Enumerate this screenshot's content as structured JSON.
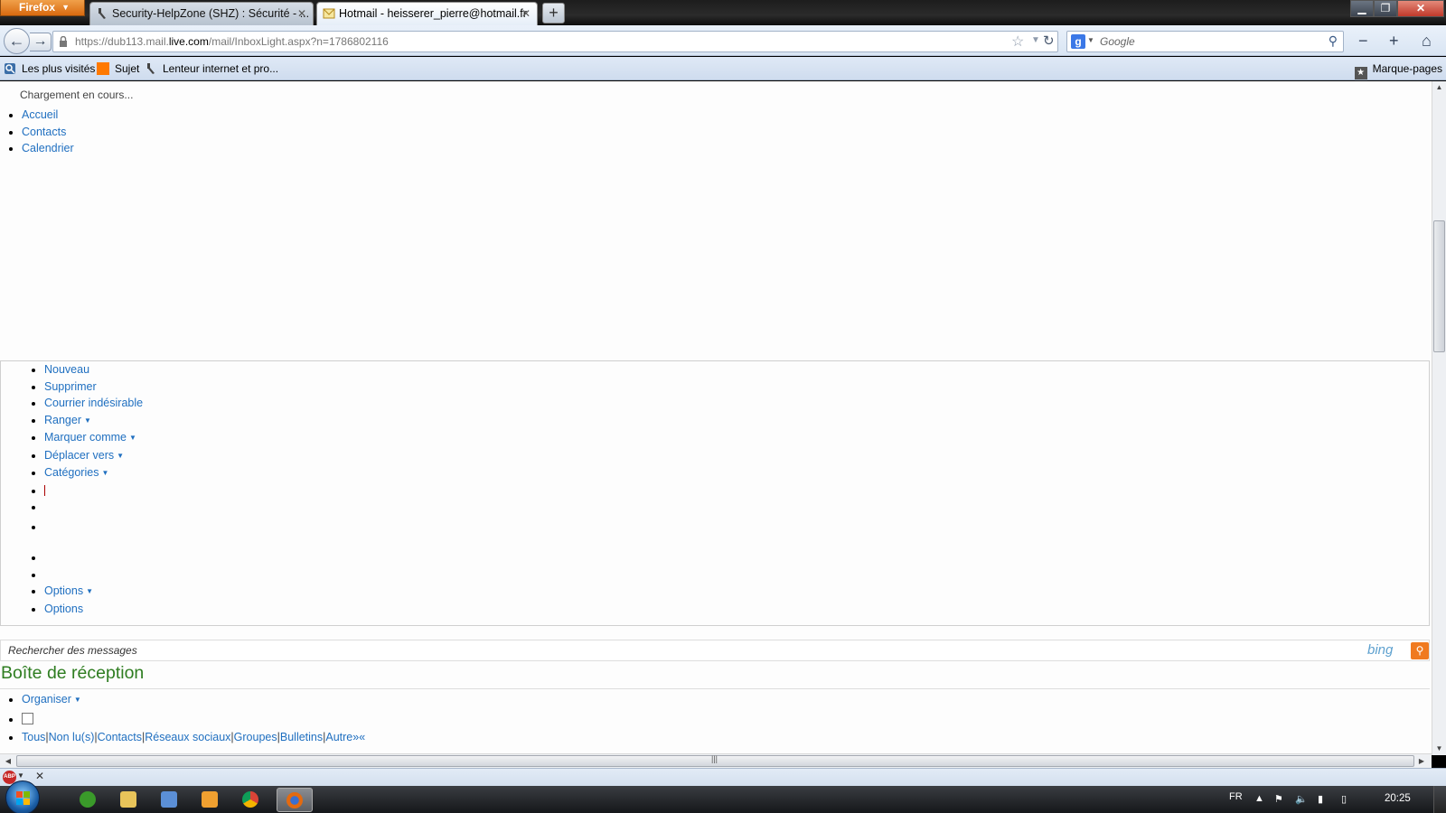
{
  "browser": {
    "menu_label": "Firefox",
    "tabs": [
      {
        "title": "Security-HelpZone (SHZ) : Sécurité - ...",
        "active": false
      },
      {
        "title": "Hotmail - heisserer_pierre@hotmail.fr",
        "active": true
      }
    ],
    "new_tab": "+",
    "url": {
      "prefix": "https://dub113.mail.",
      "domain": "live.com",
      "path": "/mail/InboxLight.aspx?n=1786802116"
    },
    "search_placeholder": "Google",
    "search_engine_letter": "g"
  },
  "bookmarks": {
    "items": [
      {
        "label": "Les plus visités"
      },
      {
        "label": "Sujet"
      },
      {
        "label": "Lenteur internet et pro..."
      }
    ],
    "right_label": "Marque-pages"
  },
  "page": {
    "loading_text": "Chargement en cours...",
    "top_nav": [
      "Accueil",
      "Contacts",
      "Calendrier"
    ],
    "toolbar": [
      {
        "label": "Nouveau",
        "dropdown": false
      },
      {
        "label": "Supprimer",
        "dropdown": false
      },
      {
        "label": "Courrier indésirable",
        "dropdown": false
      },
      {
        "label": "Ranger",
        "dropdown": true
      },
      {
        "label": "Marquer comme",
        "dropdown": true
      },
      {
        "label": "Déplacer vers",
        "dropdown": true
      },
      {
        "label": "Catégories",
        "dropdown": true
      }
    ],
    "options": [
      {
        "label": "Options",
        "dropdown": true
      },
      {
        "label": "Options",
        "dropdown": false
      }
    ],
    "search_placeholder": "Rechercher des messages",
    "bing_logo": "bing",
    "inbox_title": "Boîte de réception",
    "organize_label": "Organiser",
    "filters": [
      "Tous",
      "Non lu(s)",
      "Contacts",
      "Réseaux sociaux",
      "Groupes",
      "Bulletins",
      "Autre"
    ],
    "filters_more": "»«"
  },
  "taskbar": {
    "language": "FR",
    "clock": "20:25"
  },
  "colors": {
    "link": "#1f6fc0",
    "inbox_title": "#2e7d20",
    "firefox_orange": "#e07a20",
    "bing_button": "#f07a20"
  }
}
